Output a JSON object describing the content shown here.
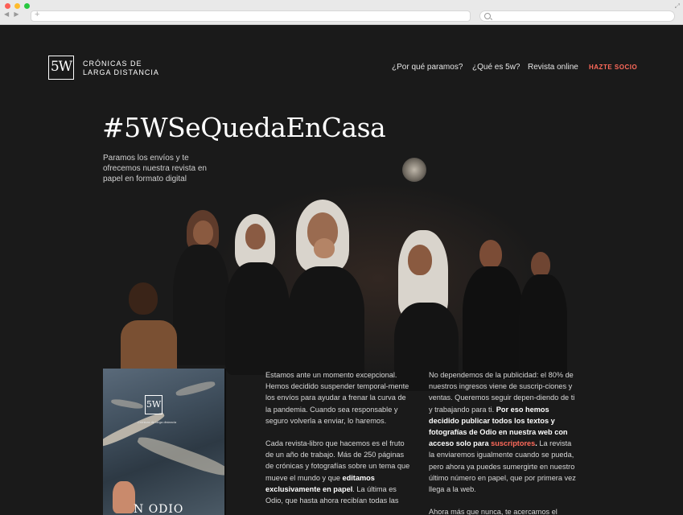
{
  "header": {
    "logo_mark": "5W",
    "logo_text_line1": "CRÓNICAS DE",
    "logo_text_line2": "LARGA DISTANCIA"
  },
  "nav": {
    "items": [
      {
        "label": "¿Por qué paramos?"
      },
      {
        "label": "¿Qué es 5w?"
      },
      {
        "label": "Revista online"
      }
    ],
    "cta_label": "HAZTE SOCIO",
    "cta_color": "#ff6a5b"
  },
  "hero": {
    "title": "#5WSeQuedaEnCasa",
    "subtitle": "Paramos los envíos y te ofrecemos nuestra revista en papel en formato digital"
  },
  "cover": {
    "logo_mark": "5W",
    "subtitle": "Crónicas de larga distancia",
    "title": "N ODIO"
  },
  "column_left": {
    "p1": "Estamos ante un momento excepcional. Hemos decidido suspender temporal-mente los envíos para ayudar a frenar la curva de la pandemia. Cuando sea responsable y seguro volverla a enviar, lo haremos.",
    "p2_a": "Cada revista-libro que hacemos es el fruto de un año de trabajo. Más de 250 páginas de crónicas y fotografías sobre un tema que mueve el mundo y que ",
    "p2_b": "editamos exclusivamente en papel",
    "p2_c": ". La última es Odio, que hasta ahora recibían todas las"
  },
  "column_right": {
    "p1_a": "No dependemos de la publicidad: el 80% de nuestros ingresos viene de suscrip-ciones y ventas. Queremos seguir depen-diendo de ti y trabajando para ti. ",
    "p1_b": "Por eso hemos decidido publicar todos los textos y fotografías de Odio en nuestra web con acceso solo para ",
    "p1_link": "suscriptores",
    "p1_c": ".",
    "p1_d": " La revista la enviaremos igualmente cuando se pueda, pero ahora ya puedes sumergirte en nuestro último número en papel, que por primera vez llega a la web.",
    "p2": "Ahora más que nunca, te acercamos el"
  }
}
